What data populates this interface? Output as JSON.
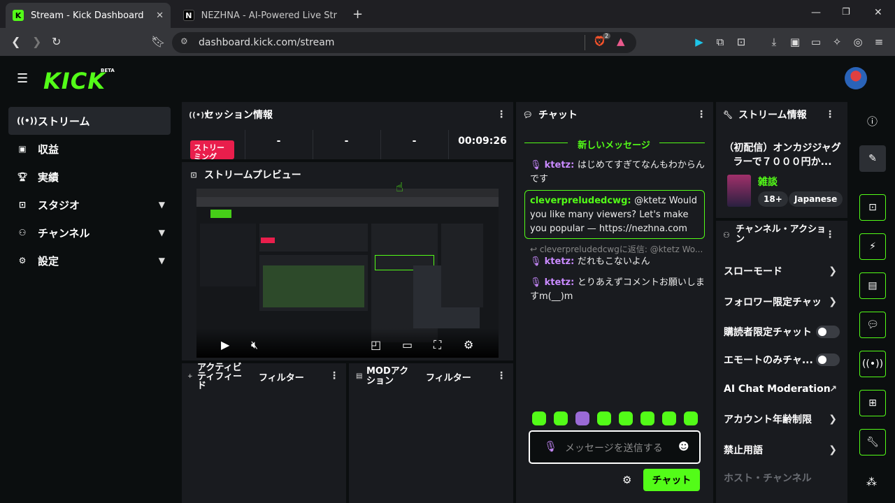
{
  "browser": {
    "tabs": [
      {
        "title": "Stream - Kick Dashboard",
        "favicon": "K",
        "active": true
      },
      {
        "title": "NEZHNA - AI-Powered Live Stream G",
        "favicon": "N",
        "active": false
      }
    ],
    "url": "dashboard.kick.com/stream",
    "brave_badge": "2"
  },
  "app": {
    "logo": "KICK",
    "logo_badge": "BETA",
    "sidebar": [
      {
        "label": "ストリーム",
        "icon": "broadcast-icon",
        "active": true
      },
      {
        "label": "収益",
        "icon": "money-icon"
      },
      {
        "label": "実績",
        "icon": "trophy-icon"
      },
      {
        "label": "スタジオ",
        "icon": "studio-icon",
        "expandable": true
      },
      {
        "label": "チャンネル",
        "icon": "channel-icon",
        "expandable": true
      },
      {
        "label": "設定",
        "icon": "gear-icon",
        "expandable": true
      }
    ],
    "session": {
      "title": "セッション情報",
      "badge": "ストリーミング",
      "cells": [
        "-",
        "-",
        "-"
      ],
      "timer": "00:09:26"
    },
    "preview": {
      "title": "ストリームプレビュー"
    },
    "activity": {
      "title": "アクティビティフィード",
      "filter": "フィルター"
    },
    "mod": {
      "title": "MODアクション",
      "filter": "フィルター"
    },
    "chat": {
      "title": "チャット",
      "new_messages": "新しいメッセージ",
      "messages": [
        {
          "user": "ktetz",
          "text": "はじめてすぎてなんもわからんです"
        },
        {
          "user": "cleverpreludedcwg",
          "text": "@ktetz Would you like many viewers? Let's make you popular — https://nezhna.com",
          "highlight": true
        },
        {
          "reply": "cleverpreludedcwgに返信: @ktetz Wo..."
        },
        {
          "user": "ktetz",
          "text": "だれもこないよん"
        },
        {
          "user": "ktetz",
          "text": "とりあえずコメントお願いしますm(__)m"
        }
      ],
      "placeholder": "メッセージを送信する",
      "send_label": "チャット"
    },
    "stream_info": {
      "title": "ストリーム情報",
      "stream_title": "（初配信）オンカジジャグラーで７０００円か...",
      "category": "雑談",
      "tags": [
        "18+",
        "Japanese"
      ]
    },
    "channel_actions": {
      "title": "チャンネル・アクション",
      "items": [
        {
          "label": "スローモード",
          "type": "arrow"
        },
        {
          "label": "フォロワー限定チャット",
          "type": "arrow"
        },
        {
          "label": "購読者限定チャット",
          "type": "toggle"
        },
        {
          "label": "エモートのみチャ...",
          "type": "toggle"
        },
        {
          "label": "AI Chat Moderation",
          "type": "external"
        },
        {
          "label": "アカウント年齢制限",
          "type": "arrow"
        },
        {
          "label": "禁止用語",
          "type": "arrow"
        }
      ],
      "section_label": "ホスト・チャンネル"
    },
    "colors": {
      "accent": "#53fc18",
      "live": "#e91e4c",
      "chat_user": "#c98aff"
    }
  }
}
